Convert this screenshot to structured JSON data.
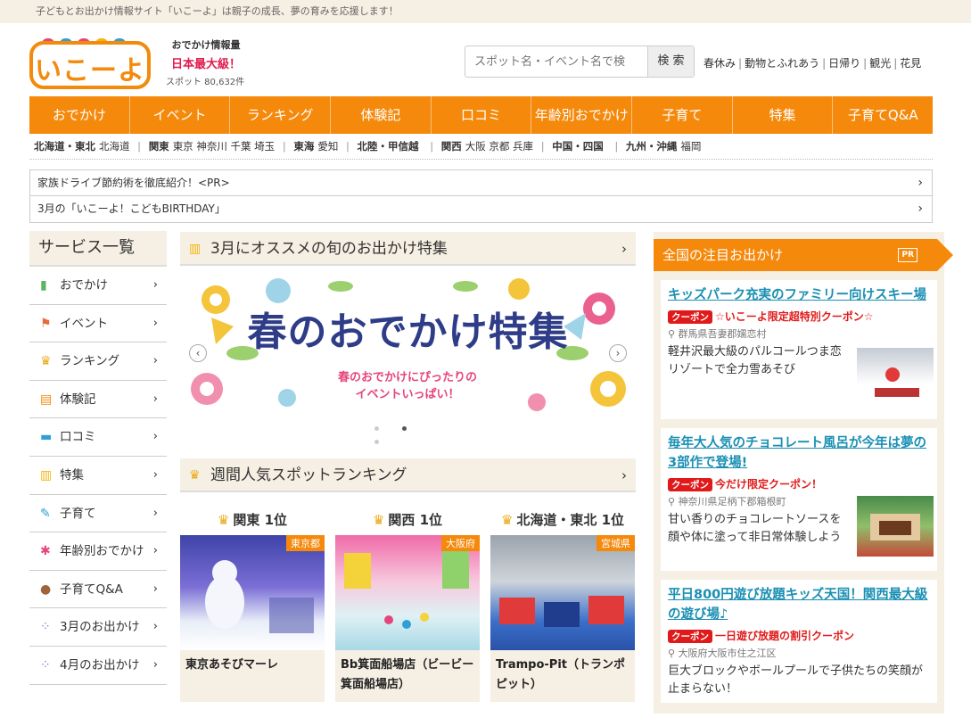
{
  "topbar": {
    "text": "子どもとお出かけ情報サイト「いこーよ」は親子の成長、夢の育みを応援します！"
  },
  "logo": {
    "text": "いこーよ"
  },
  "info": {
    "line1": "おでかけ情報量",
    "line2": "日本最大級！",
    "line3": "スポット 80,632件"
  },
  "search": {
    "placeholder": "スポット名・イベント名で検",
    "button": "検 索"
  },
  "quick_links": [
    "春休み",
    "動物とふれあう",
    "日帰り",
    "観光",
    "花見"
  ],
  "nav": [
    "おでかけ",
    "イベント",
    "ランキング",
    "体験記",
    "口コミ",
    "年齢別おでかけ",
    "子育て",
    "特集",
    "子育てQ&A"
  ],
  "areas": [
    {
      "region": "北海道・東北",
      "prefs": [
        "北海道"
      ]
    },
    {
      "region": "関東",
      "prefs": [
        "東京",
        "神奈川",
        "千葉",
        "埼玉"
      ]
    },
    {
      "region": "東海",
      "prefs": [
        "愛知"
      ]
    },
    {
      "region": "北陸・甲信越",
      "prefs": []
    },
    {
      "region": "関西",
      "prefs": [
        "大阪",
        "京都",
        "兵庫"
      ]
    },
    {
      "region": "中国・四国",
      "prefs": []
    },
    {
      "region": "九州・沖縄",
      "prefs": [
        "福岡"
      ]
    }
  ],
  "notices": [
    "家族ドライブ節約術を徹底紹介！<PR>",
    "3月の「いこーよ！こどもBIRTHDAY」"
  ],
  "services": {
    "title": "サービス一覧",
    "items": [
      {
        "label": "おでかけ",
        "icon": "chart-icon"
      },
      {
        "label": "イベント",
        "icon": "flag-icon"
      },
      {
        "label": "ランキング",
        "icon": "crown-icon"
      },
      {
        "label": "体験記",
        "icon": "notebook-icon"
      },
      {
        "label": "口コミ",
        "icon": "chat-icon"
      },
      {
        "label": "特集",
        "icon": "book-icon"
      },
      {
        "label": "子育て",
        "icon": "pencil-icon"
      },
      {
        "label": "年齢別おでかけ",
        "icon": "running-icon"
      },
      {
        "label": "子育てQ&A",
        "icon": "question-icon"
      },
      {
        "label": "3月のお出かけ",
        "icon": "footprint-icon"
      },
      {
        "label": "4月のお出かけ",
        "icon": "footprint-icon"
      }
    ]
  },
  "feature": {
    "title": "3月にオススメの旬のお出かけ特集",
    "banner_title": "春のおでかけ特集",
    "banner_sub1": "春のおでかけにぴったりの",
    "banner_sub2": "イベントいっぱい！"
  },
  "ranking": {
    "title": "週間人気スポットランキング",
    "cols": [
      {
        "heading": "関東 1位",
        "tag": "東京都",
        "name": "東京あそびマーレ"
      },
      {
        "heading": "関西 1位",
        "tag": "大阪府",
        "name": "Bb箕面船場店（ビービー箕面船場店）"
      },
      {
        "heading": "北海道・東北 1位",
        "tag": "宮城県",
        "name": "Trampo-Pit（トランポピット）"
      }
    ]
  },
  "side": {
    "title": "全国の注目お出かけ",
    "pr": "PR",
    "cards": [
      {
        "title": "キッズパーク充実のファミリー向けスキー場",
        "coupon_tag": "クーポン",
        "coupon": "☆いこーよ限定超特別クーポン☆",
        "loc": "群馬県吾妻郡嬬恋村",
        "desc": "軽井沢最大級のパルコールつま恋リゾートで全力雪あそび"
      },
      {
        "title": "毎年大人気のチョコレート風呂が今年は夢の3部作で登場!",
        "coupon_tag": "クーポン",
        "coupon": "今だけ限定クーポン！",
        "loc": "神奈川県足柄下郡箱根町",
        "desc": "甘い香りのチョコレートソースを顔や体に塗って非日常体験しよう"
      },
      {
        "title": "平日800円遊び放題キッズ天国！関西最大級の遊び場♪",
        "coupon_tag": "クーポン",
        "coupon": "一日遊び放題の割引クーポン",
        "loc": "大阪府大阪市住之江区",
        "desc": "巨大ブロックやボールプールで子供たちの笑顔が止まらない！"
      }
    ]
  },
  "colors": {
    "accent": "#f5890c",
    "beige": "#f6efe3",
    "link": "#1a8fb3",
    "coupon": "#e01a1a"
  }
}
